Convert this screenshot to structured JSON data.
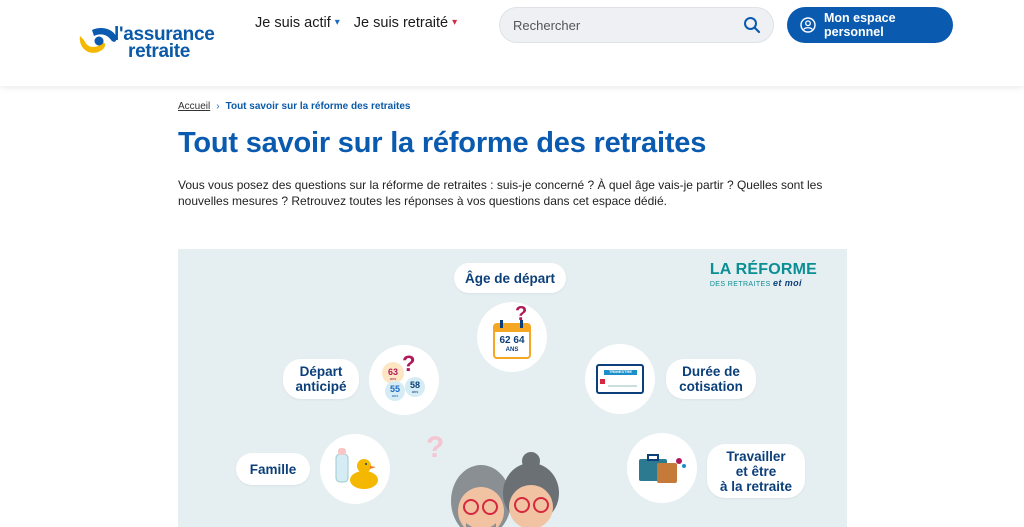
{
  "header": {
    "logo": {
      "line1": "l'assurance",
      "line2": "retraite"
    },
    "nav": [
      {
        "label": "Je suis actif"
      },
      {
        "label": "Je suis retraité"
      }
    ],
    "search": {
      "placeholder": "Rechercher"
    },
    "account_button": "Mon espace personnel",
    "colors": {
      "brand_blue": "#0a5bb0",
      "accent_red": "#d6283f",
      "logo_yellow": "#f5b800"
    }
  },
  "breadcrumb": {
    "home": "Accueil",
    "current": "Tout savoir sur la réforme des retraites"
  },
  "page": {
    "title": "Tout savoir sur la réforme des retraites",
    "intro": "Vous vous posez des questions sur la réforme de retraites : suis-je concerné ? À quel âge vais-je partir ? Quelles sont les nouvelles mesures ? Retrouvez toutes les réponses à vos questions dans cet espace dédié."
  },
  "hero": {
    "brand_title": "LA RÉFORME",
    "brand_sub": "DES RETRAITES",
    "brand_et_moi": "et moi",
    "topics": [
      {
        "label": "Âge de départ"
      },
      {
        "label": "Départ\nanticipé"
      },
      {
        "label": "Durée de\ncotisation"
      },
      {
        "label": "Famille"
      },
      {
        "label": "Travailler\net être\nà la retraite"
      }
    ],
    "icons": {
      "calendar": {
        "numbers": "62 64",
        "unit": "ANS"
      },
      "bubbles": [
        "63",
        "55",
        "58"
      ],
      "bubble_unit": "ans",
      "card_label": "TRIMESTRE"
    }
  }
}
